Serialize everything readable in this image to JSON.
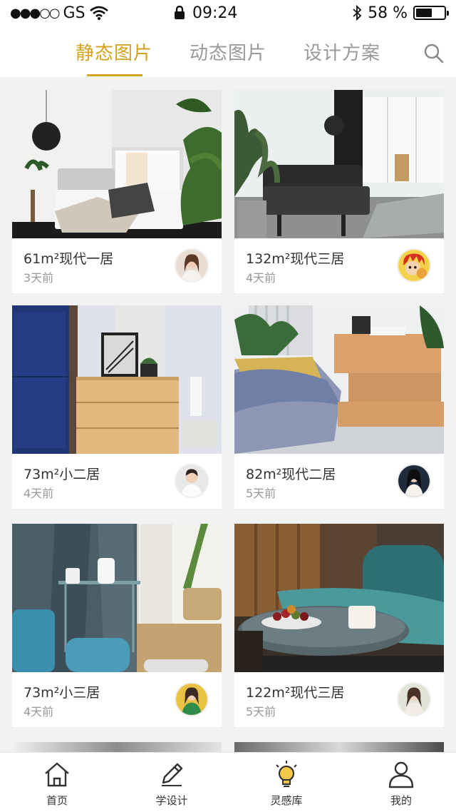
{
  "status_bar": {
    "signal": "●●●○○",
    "carrier": "GS",
    "time": "09:24",
    "battery": "58 %",
    "battery_level": 0.58
  },
  "top_tabs": [
    {
      "label": "静态图片",
      "active": true
    },
    {
      "label": "动态图片",
      "active": false
    },
    {
      "label": "设计方案",
      "active": false
    }
  ],
  "cards": [
    {
      "title": "61m²现代一居",
      "time": "3天前"
    },
    {
      "title": "132m²现代三居",
      "time": "4天前"
    },
    {
      "title": "73m²小二居",
      "time": "4天前"
    },
    {
      "title": "82m²现代二居",
      "time": "5天前"
    },
    {
      "title": "73m²小三居",
      "time": "4天前"
    },
    {
      "title": "122m²现代三居",
      "time": "5天前"
    }
  ],
  "bottom_nav": [
    {
      "label": "首页",
      "icon": "home-icon"
    },
    {
      "label": "学设计",
      "icon": "pencil-icon"
    },
    {
      "label": "灵感库",
      "icon": "lightbulb-icon"
    },
    {
      "label": "我的",
      "icon": "user-icon"
    }
  ],
  "colors": {
    "accent": "#d4a21e"
  }
}
